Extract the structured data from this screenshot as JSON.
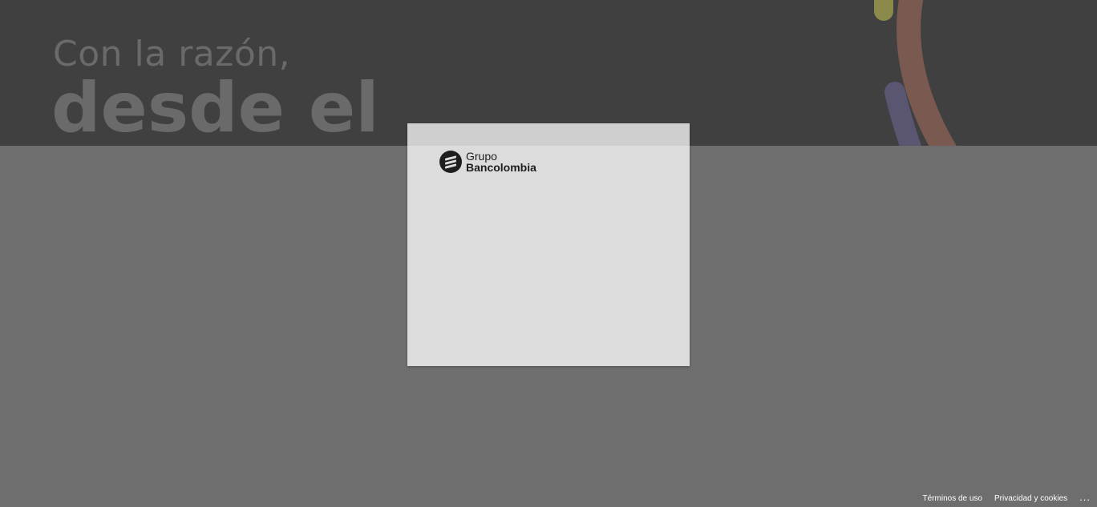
{
  "hero": {
    "line1": "Con la razón,",
    "line2": "desde el"
  },
  "card": {
    "logo": {
      "line1": "Grupo",
      "line2": "Bancolombia"
    }
  },
  "footer": {
    "terms": "Términos de uso",
    "privacy": "Privacidad y cookies",
    "more": "..."
  },
  "colors": {
    "hero_background": "#404040",
    "overlay": "#6e6e6e",
    "card_background": "#dcdcdc",
    "deco_olive": "#8c8a4a",
    "deco_brown": "#7a5a50",
    "deco_purple": "#5a5570"
  },
  "icons": {
    "logo_mark": "bancolombia-logo-icon",
    "more": "ellipsis-icon"
  }
}
